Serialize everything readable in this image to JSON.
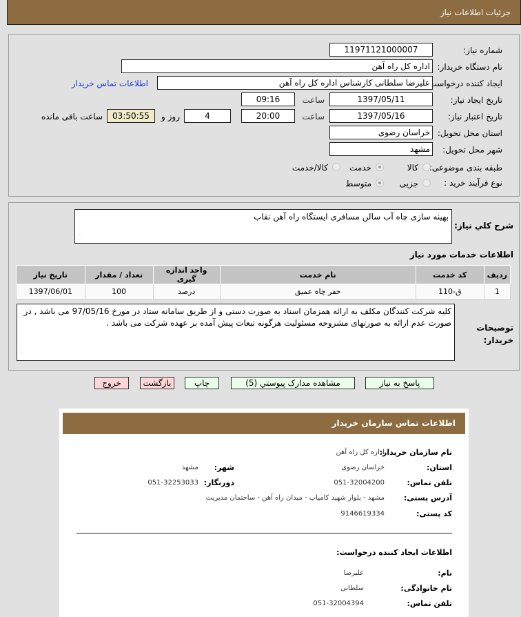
{
  "header": {
    "title": "جزئیات اطلاعات نیاز"
  },
  "form": {
    "need_number": {
      "label": "شماره نیاز:",
      "value": "11971121000007"
    },
    "buyer_org": {
      "label": "نام دستگاه خریدار:",
      "value": "اداره کل راه آهن"
    },
    "requester": {
      "label": "ایجاد کننده درخواست:",
      "value": "علیرضا  سلطانی  کارشناس اداره کل راه آهن",
      "contact_link": "اطلاعات تماس خریدار"
    },
    "created": {
      "label": "تاریخ ایجاد نیاز:",
      "date": "1397/05/11",
      "time_label": "ساعت",
      "time": "09:16"
    },
    "validity": {
      "label": "تاریخ اعتبار نیاز:",
      "date": "1397/05/16",
      "time_label": "ساعت",
      "time": "20:00",
      "days": "4",
      "days_label": "روز و",
      "remaining": "03:50:55",
      "remaining_label": "ساعت باقی مانده"
    },
    "province": {
      "label": "استان محل تحویل:",
      "value": "خراسان رضوی"
    },
    "city": {
      "label": "شهر محل تحویل:",
      "value": "مشهد"
    },
    "category": {
      "label": "طبقه بندی موضوعی:",
      "options": [
        "کالا",
        "خدمت",
        "کالا/خدمت"
      ],
      "selected": "خدمت"
    },
    "purchase_type": {
      "label": "نوع فرآیند خرید :",
      "options": [
        "جزیی",
        "متوسط"
      ],
      "selected": "متوسط"
    }
  },
  "description": {
    "label": "شرح کلي نياز:",
    "value": "بهینه سازی چاه آب سالن مسافری ایستگاه راه آهن نقاب"
  },
  "services": {
    "title": "اطلاعات خدمات مورد نیاز",
    "columns": [
      "ردیف",
      "کد خدمت",
      "نام خدمت",
      "واحد اندازه گیری",
      "تعداد / مقدار",
      "تاریخ نیاز"
    ],
    "rows": [
      [
        "1",
        "ق-110",
        "حفر چاه عمیق",
        "درصد",
        "100",
        "1397/06/01"
      ]
    ]
  },
  "buyer_notes": {
    "label": "توضیحات خریدار:",
    "value": "کلیه شرکت کنندگان مکلف به ارائه همزمان اسناد به صورت دستی و از طریق سامانه ستاد در مورخ 97/05/16 می باشد , در صورت عدم ارائه به صورتهای مشروحه مسئولیت هرگونه تبعات پیش آمده بر عهده  شرکت  می باشد ."
  },
  "buttons": {
    "respond": "پاسخ به نیاز",
    "attachments": "مشاهده مدارک پیوستي (5)",
    "print": "چاپ",
    "back": "بازگشت",
    "exit": "خروج"
  },
  "contact": {
    "title": "اطلاعات تماس سازمان خریدار",
    "org_name": {
      "label": "نام سازمان خریدار:",
      "value": "اداره کل راه آهن"
    },
    "province": {
      "label": "استان:",
      "value": "خراسان رضوی"
    },
    "city": {
      "label": "شهر:",
      "value": "مشهد"
    },
    "phone": {
      "label": "تلفن تماس:",
      "value": "051-32004200"
    },
    "fax": {
      "label": "دورنگار:",
      "value": "051-32253033"
    },
    "address": {
      "label": "آدرس پستی:",
      "value": "مشهد - بلوار شهید کامیاب - میدان راه آهن - ساختمان مدیریت"
    },
    "postal_code": {
      "label": "کد پستی:",
      "value": "9146619334"
    },
    "requester_title": "اطلاعات ایجاد کننده درخواست:",
    "requester_first": {
      "label": "نام:",
      "value": "علیرضا"
    },
    "requester_last": {
      "label": "نام خانوادگی:",
      "value": "سلطانی"
    },
    "requester_phone": {
      "label": "تلفن تماس:",
      "value": "051-32004394"
    }
  }
}
